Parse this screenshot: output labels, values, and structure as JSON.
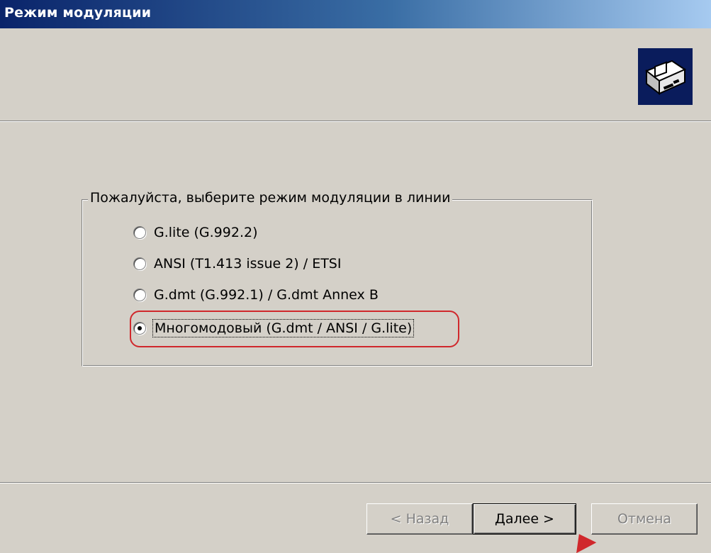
{
  "window": {
    "title": "Режим модуляции"
  },
  "group": {
    "legend": "Пожалуйста, выберите режим модуляции в линии",
    "options": [
      {
        "label": "G.lite (G.992.2)",
        "checked": false
      },
      {
        "label": "ANSI (T1.413 issue 2) / ETSI",
        "checked": false
      },
      {
        "label": "G.dmt (G.992.1) / G.dmt Annex B",
        "checked": false
      },
      {
        "label": "Многомодовый (G.dmt / ANSI / G.lite)",
        "checked": true
      }
    ]
  },
  "buttons": {
    "back": {
      "label": "< Назад",
      "enabled": false
    },
    "next": {
      "label": "Далее >",
      "enabled": true
    },
    "cancel": {
      "label": "Отмена",
      "enabled": false
    }
  },
  "icons": {
    "wizard": "modem-card-icon",
    "radio_selected": "radio-dot"
  },
  "colors": {
    "titlebar_start": "#0a246a",
    "titlebar_end": "#a6caf0",
    "highlight": "#d0282c",
    "face": "#d4d0c8"
  }
}
